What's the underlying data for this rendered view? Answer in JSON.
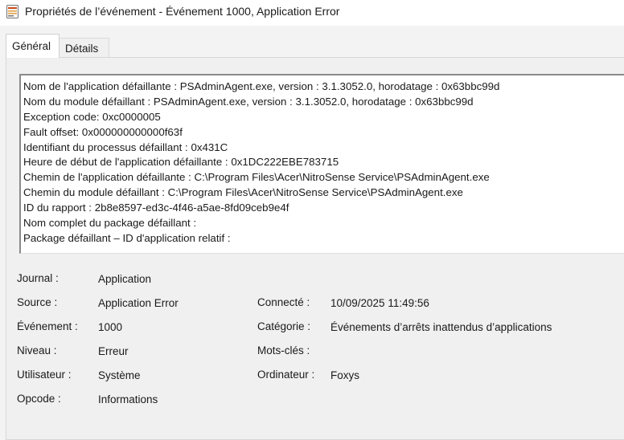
{
  "window": {
    "title": "Propriétés de l’événement - Événement 1000, Application Error"
  },
  "tabs": [
    {
      "label": "Général",
      "active": true
    },
    {
      "label": "Détails",
      "active": false
    }
  ],
  "description": [
    "Nom de l'application défaillante : PSAdminAgent.exe, version : 3.1.3052.0, horodatage : 0x63bbc99d",
    "Nom du module défaillant : PSAdminAgent.exe, version : 3.1.3052.0, horodatage : 0x63bbc99d",
    "Exception code: 0xc0000005",
    "Fault offset: 0x000000000000f63f",
    "Identifiant du processus défaillant : 0x431C",
    "Heure de début de l'application défaillante : 0x1DC222EBE783715",
    "Chemin de l'application défaillante : C:\\Program Files\\Acer\\NitroSense Service\\PSAdminAgent.exe",
    "Chemin du module défaillant : C:\\Program Files\\Acer\\NitroSense Service\\PSAdminAgent.exe",
    "ID du rapport : 2b8e8597-ed3c-4f46-a5ae-8fd09ceb9e4f",
    "Nom complet du package défaillant :",
    "Package défaillant – ID d'application relatif :"
  ],
  "fields": {
    "journal": {
      "label": "Journal :",
      "value": "Application"
    },
    "source": {
      "label": "Source :",
      "value": "Application Error"
    },
    "evenement": {
      "label": "Événement :",
      "value": "1000"
    },
    "niveau": {
      "label": "Niveau :",
      "value": "Erreur"
    },
    "utilisateur": {
      "label": "Utilisateur :",
      "value": "Système"
    },
    "opcode": {
      "label": "Opcode :",
      "value": "Informations"
    },
    "connecte": {
      "label": "Connecté :",
      "value": "10/09/2025 11:49:56"
    },
    "categorie": {
      "label": "Catégorie :",
      "value": "Événements d’arrêts inattendus d’applications"
    },
    "motscles": {
      "label": "Mots-clés :",
      "value": ""
    },
    "ordinateur": {
      "label": "Ordinateur :",
      "value": "Foxys"
    }
  },
  "colors": {
    "background": "#f3f3f3",
    "text": "#1a1a1a",
    "icon_accent": "#d04a1a"
  }
}
